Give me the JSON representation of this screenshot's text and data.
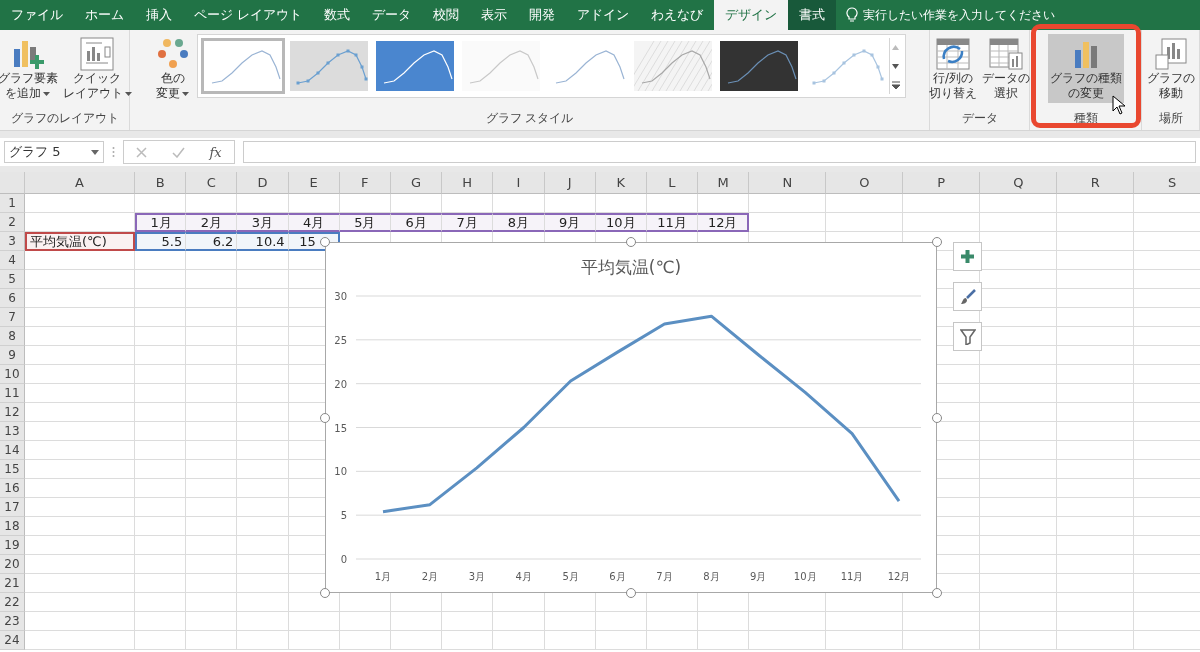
{
  "tabs": [
    {
      "label": "ファイル",
      "selected": false,
      "contextual": false
    },
    {
      "label": "ホーム",
      "selected": false,
      "contextual": false
    },
    {
      "label": "挿入",
      "selected": false,
      "contextual": false
    },
    {
      "label": "ページ レイアウト",
      "selected": false,
      "contextual": false
    },
    {
      "label": "数式",
      "selected": false,
      "contextual": false
    },
    {
      "label": "データ",
      "selected": false,
      "contextual": false
    },
    {
      "label": "校閲",
      "selected": false,
      "contextual": false
    },
    {
      "label": "表示",
      "selected": false,
      "contextual": false
    },
    {
      "label": "開発",
      "selected": false,
      "contextual": false
    },
    {
      "label": "アドイン",
      "selected": false,
      "contextual": false
    },
    {
      "label": "わえなび",
      "selected": false,
      "contextual": false
    },
    {
      "label": "デザイン",
      "selected": true,
      "contextual": true
    },
    {
      "label": "書式",
      "selected": false,
      "contextual": true
    }
  ],
  "tell_me": {
    "placeholder": "実行したい作業を入力してください"
  },
  "ribbon": {
    "groups": [
      {
        "label": "グラフのレイアウト",
        "buttons": [
          {
            "kind": "add-element",
            "lines": [
              "グラフ要素",
              "を追加"
            ],
            "dropdown": true,
            "hovered": false
          },
          {
            "kind": "quick-layout",
            "lines": [
              "クイック",
              "レイアウト"
            ],
            "dropdown": true,
            "hovered": false
          }
        ]
      },
      {
        "label": "グラフ スタイル",
        "buttons": [
          {
            "kind": "colors",
            "lines": [
              "色の",
              "変更"
            ],
            "dropdown": true,
            "hovered": false
          }
        ],
        "gallery": [
          {
            "kind": "plain",
            "selected": true
          },
          {
            "kind": "gray-markers",
            "selected": false
          },
          {
            "kind": "blue",
            "selected": false
          },
          {
            "kind": "faint",
            "selected": false
          },
          {
            "kind": "plain",
            "selected": false
          },
          {
            "kind": "hatched",
            "selected": false
          },
          {
            "kind": "dark",
            "selected": false
          },
          {
            "kind": "markers",
            "selected": false
          }
        ]
      },
      {
        "label": "データ",
        "buttons": [
          {
            "kind": "switch-row-column",
            "lines": [
              "行/列の",
              "切り替え"
            ],
            "dropdown": false,
            "hovered": false
          },
          {
            "kind": "select-data",
            "lines": [
              "データの",
              "選択"
            ],
            "dropdown": false,
            "hovered": false
          }
        ]
      },
      {
        "label": "種類",
        "highlighted": true,
        "buttons": [
          {
            "kind": "change-type",
            "lines": [
              "グラフの種類",
              "の変更"
            ],
            "dropdown": false,
            "hovered": true
          }
        ]
      },
      {
        "label": "場所",
        "buttons": [
          {
            "kind": "move",
            "lines": [
              "グラフの",
              "移動"
            ],
            "dropdown": false,
            "hovered": false
          }
        ]
      }
    ]
  },
  "formula_bar": {
    "name_box": "グラフ 5",
    "function_label": "fx"
  },
  "sheet": {
    "columns": [
      "A",
      "B",
      "C",
      "D",
      "E",
      "F",
      "G",
      "H",
      "I",
      "J",
      "K",
      "L",
      "M",
      "N",
      "O",
      "P",
      "Q",
      "R",
      "S"
    ],
    "rows": [
      {
        "number": "1"
      },
      {
        "number": "2",
        "cells": [
          null,
          {
            "text": "1月",
            "color": "#8a67b8"
          },
          {
            "text": "2月",
            "color": "#8a67b8"
          },
          {
            "text": "3月",
            "color": "#8a67b8"
          },
          {
            "text": "4月",
            "color": "#8a67b8"
          },
          {
            "text": "5月",
            "color": "#8a67b8"
          },
          {
            "text": "6月",
            "color": "#8a67b8"
          },
          {
            "text": "7月",
            "color": "#8a67b8"
          },
          {
            "text": "8月",
            "color": "#8a67b8"
          },
          {
            "text": "9月",
            "color": "#8a67b8"
          },
          {
            "text": "10月",
            "color": "#8a67b8"
          },
          {
            "text": "11月",
            "color": "#8a67b8"
          },
          {
            "text": "12月",
            "color": "#8a67b8"
          }
        ]
      },
      {
        "number": "3",
        "cells": [
          {
            "text": "平均気温(℃)",
            "color": "#c04a4a"
          },
          {
            "text": "5.5",
            "color": "#4a7cc0"
          },
          {
            "text": "6.2",
            "color": "#4a7cc0"
          },
          {
            "text": "10.4",
            "color": "#4a7cc0"
          },
          {
            "text": "15",
            "color": "#4a7cc0",
            "clipped": true
          }
        ]
      },
      {
        "number": "4"
      },
      {
        "number": "5"
      },
      {
        "number": "6"
      },
      {
        "number": "7"
      },
      {
        "number": "8"
      },
      {
        "number": "9"
      },
      {
        "number": "10"
      },
      {
        "number": "11"
      },
      {
        "number": "12"
      },
      {
        "number": "13"
      },
      {
        "number": "14"
      },
      {
        "number": "15"
      },
      {
        "number": "16"
      },
      {
        "number": "17"
      },
      {
        "number": "18"
      },
      {
        "number": "19"
      },
      {
        "number": "20"
      },
      {
        "number": "21"
      },
      {
        "number": "22"
      },
      {
        "number": "23"
      },
      {
        "number": "24"
      }
    ],
    "chart": {
      "chart_data": {
        "type": "line",
        "title": "平均気温(℃)",
        "categories": [
          "1月",
          "2月",
          "3月",
          "4月",
          "5月",
          "6月",
          "7月",
          "8月",
          "9月",
          "10月",
          "11月",
          "12月"
        ],
        "series": [
          {
            "color": "#5b8fc2",
            "values": [
              5.4,
              6.2,
              10.4,
              15.0,
              20.3,
              23.6,
              26.8,
              27.7,
              23.3,
              19.0,
              14.3,
              6.6
            ]
          }
        ],
        "ylim": [
          0,
          30
        ],
        "yticks": [
          0,
          5,
          10,
          15,
          20,
          25,
          30
        ],
        "grid": true
      }
    }
  }
}
